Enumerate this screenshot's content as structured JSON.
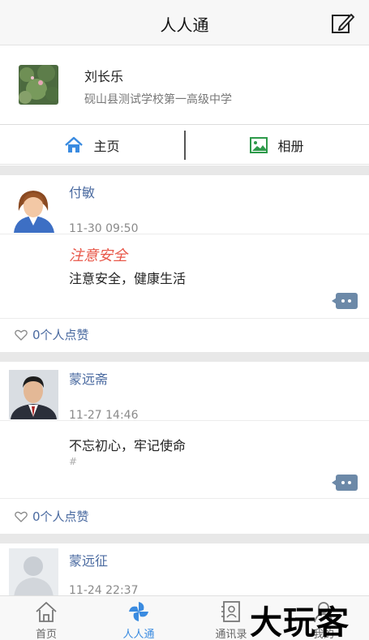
{
  "header": {
    "title": "人人通",
    "edit_icon": "edit-icon"
  },
  "profile": {
    "name": "刘长乐",
    "school": "砚山县测试学校第一高级中学"
  },
  "segment": {
    "home_label": "主页",
    "album_label": "相册"
  },
  "posts": [
    {
      "author": "付敏",
      "time": "11-30 09:50",
      "title": "注意安全",
      "body": "注意安全，健康生活",
      "likes": "0个人点赞"
    },
    {
      "author": "蒙远斋",
      "time": "11-27 14:46",
      "body": "不忘初心，牢记使命",
      "hash": "#",
      "likes": "0个人点赞"
    },
    {
      "author": "蒙远征",
      "time": "11-24 22:37"
    }
  ],
  "tabbar": {
    "items": [
      {
        "label": "首页",
        "icon": "home-icon"
      },
      {
        "label": "人人通",
        "icon": "pinwheel-icon",
        "active": true
      },
      {
        "label": "通讯录",
        "icon": "contacts-icon"
      },
      {
        "label": "我的",
        "icon": "user-icon"
      }
    ]
  },
  "watermark": "大玩客",
  "colors": {
    "accent": "#3a8be0",
    "name_blue": "#4a6aa0",
    "title_red": "#e8584a"
  }
}
